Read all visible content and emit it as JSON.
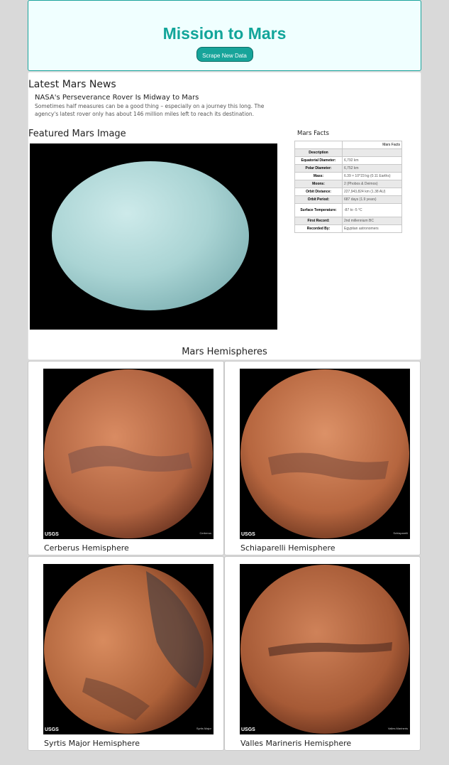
{
  "header": {
    "title": "Mission to Mars",
    "scrape_label": "Scrape New Data"
  },
  "news": {
    "section_title": "Latest Mars News",
    "headline": "NASA's Perseverance Rover Is Midway to Mars",
    "teaser": "Sometimes half measures can be a good thing – especially on a journey this long. The agency's latest rover only has about 146 million miles left to reach its destination."
  },
  "featured": {
    "section_title": "Featured Mars Image"
  },
  "facts": {
    "section_title": "Mars Facts",
    "column_header": "Mars Facts",
    "rows": [
      {
        "key": "Description",
        "value": ""
      },
      {
        "key": "Equatorial Diameter:",
        "value": "6,792 km"
      },
      {
        "key": "Polar Diameter:",
        "value": "6,752 km"
      },
      {
        "key": "Mass:",
        "value": "6.39 × 10^23 kg (0.11 Earths)"
      },
      {
        "key": "Moons:",
        "value": "2 (Phobos & Deimos)"
      },
      {
        "key": "Orbit Distance:",
        "value": "227,943,824 km (1.38 AU)"
      },
      {
        "key": "Orbit Period:",
        "value": "687 days (1.9 years)"
      },
      {
        "key": "Surface Temperature:",
        "value": "-87 to -5 °C"
      },
      {
        "key": "First Record:",
        "value": "2nd millennium BC"
      },
      {
        "key": "Recorded By:",
        "value": "Egyptian astronomers"
      }
    ]
  },
  "hemispheres": {
    "section_title": "Mars Hemispheres",
    "items": [
      {
        "title": "Cerberus Hemisphere",
        "badge": "USGS",
        "image_label": "Cerberus"
      },
      {
        "title": "Schiaparelli Hemisphere",
        "badge": "USGS",
        "image_label": "Schiaparelli"
      },
      {
        "title": "Syrtis Major Hemisphere",
        "badge": "USGS",
        "image_label": "Syrtis Major"
      },
      {
        "title": "Valles Marineris Hemisphere",
        "badge": "USGS",
        "image_label": "Valles Marineris"
      }
    ]
  },
  "colors": {
    "accent": "#17a49a",
    "jumbotron_bg": "#f0ffff",
    "page_bg": "#d9d9d9"
  }
}
